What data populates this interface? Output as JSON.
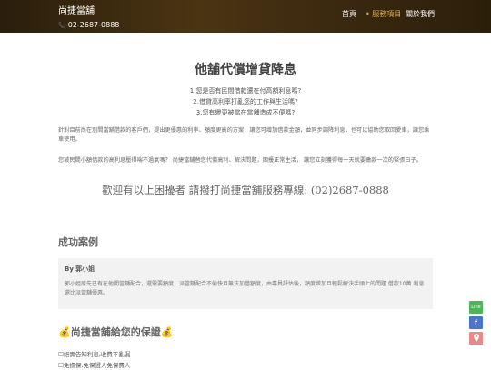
{
  "header": {
    "brand": "尚捷當舖",
    "phone_icon": "phone-icon",
    "phone": "02-2687-0888"
  },
  "nav": {
    "home": "首頁",
    "services": "服務項目",
    "about": "關於我們"
  },
  "main": {
    "title": "他舖代償增貸降息",
    "questions": [
      "1.您是否有民間借款還在付高額利息嗎?",
      "2.借貸高利率打亂您的工作與生活嗎?",
      "3.您有變更被當在當舖造成不便嗎?"
    ],
    "para1": "針對目前尚在別間當舖借款的客戶們，提出更優惠的利率、額度更高的方案，讓您可增加借款金額，並同步調降利息，也可以協助您取回愛車，讓您乘車使用。",
    "para2": "您被民間小額借款的高利息壓得喘不過氣嗎？ 尚捷當舖替您代償高利、解決問題，困擾正常生活， 讓您立刻獲得每十天就要繳款一次的緊張日子。",
    "cta": "歡迎有以上困擾者 請撥打尚捷當舖服務專線: (02)2687-0888"
  },
  "cases": {
    "title": "成功案例",
    "author_prefix": "By",
    "author": "郭小姐",
    "text": "郭小姐原先已有在他間當舖配合，還需要額度，派當舖配合不偷快且無法加借額度，由專員評估後，額度增加且輕鬆解決手頭上的問題 借款10萬 利息還比派當舖優惠。"
  },
  "protect": {
    "title": "💰尚捷當舖給您的保證💰",
    "items": [
      "☐絕實告知利息,收費不亂漏",
      "☐免擔保,免保證人免保費人"
    ]
  },
  "float_buttons": {
    "line": "Line",
    "facebook": "f",
    "map_icon": "map-pin-icon"
  },
  "colors": {
    "header_bg": "#3a2810",
    "nav_active": "#e0b050",
    "line_green": "#51b357",
    "facebook_blue": "#4c74cf",
    "map_pink": "#e68a8a"
  }
}
